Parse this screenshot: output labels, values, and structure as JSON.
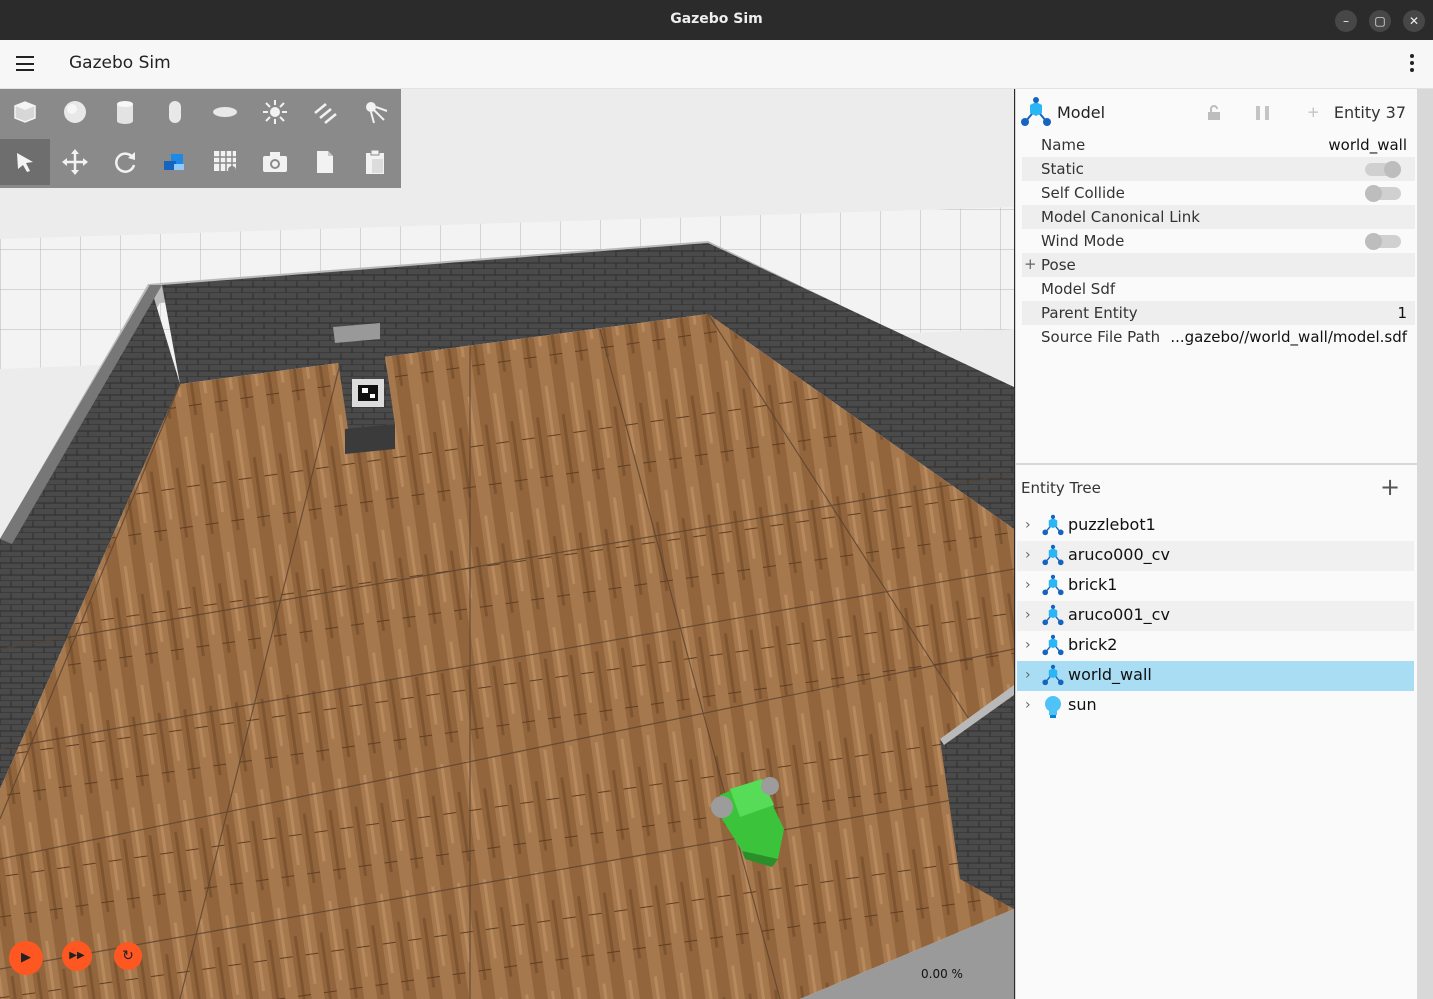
{
  "window": {
    "title": "Gazebo Sim",
    "controls": [
      "–",
      "▢",
      "✕"
    ]
  },
  "app": {
    "title": "Gazebo Sim"
  },
  "toolbar": {
    "row1": [
      {
        "name": "box-icon"
      },
      {
        "name": "sphere-icon"
      },
      {
        "name": "cylinder-icon"
      },
      {
        "name": "capsule-icon"
      },
      {
        "name": "ellipsoid-icon"
      },
      {
        "name": "point-light-icon"
      },
      {
        "name": "directional-light-icon"
      },
      {
        "name": "spot-light-icon"
      }
    ],
    "row2": [
      {
        "name": "select-mode-icon"
      },
      {
        "name": "translate-mode-icon"
      },
      {
        "name": "rotate-mode-icon"
      },
      {
        "name": "snap-icon"
      },
      {
        "name": "grid-align-icon"
      },
      {
        "name": "screenshot-icon"
      },
      {
        "name": "copy-icon"
      },
      {
        "name": "paste-icon"
      }
    ]
  },
  "playback": {
    "real_time_factor": "0.00 %"
  },
  "component_inspector": {
    "type": "Model",
    "entity": "Entity 37",
    "lock_icon": "lock-icon",
    "pause_icon": "pause-icon",
    "add_label": "+",
    "properties": [
      {
        "label": "Name",
        "value": "world_wall"
      },
      {
        "label": "Static",
        "toggle": true,
        "on": true
      },
      {
        "label": "Self Collide",
        "toggle": true,
        "on": false
      },
      {
        "label": "Model Canonical Link",
        "value": ""
      },
      {
        "label": "Wind Mode",
        "toggle": true,
        "on": false
      },
      {
        "label": "Pose",
        "value": "",
        "expander": "+"
      },
      {
        "label": "Model Sdf",
        "value": ""
      },
      {
        "label": "Parent Entity",
        "value": "1"
      },
      {
        "label": "Source File Path",
        "value": "...gazebo//world_wall/model.sdf"
      }
    ]
  },
  "entity_tree": {
    "title": "Entity Tree",
    "add_label": "+",
    "items": [
      {
        "label": "puzzlebot1",
        "icon": "model-icon"
      },
      {
        "label": "aruco000_cv",
        "icon": "model-icon"
      },
      {
        "label": "brick1",
        "icon": "model-icon"
      },
      {
        "label": "aruco001_cv",
        "icon": "model-icon"
      },
      {
        "label": "brick2",
        "icon": "model-icon"
      },
      {
        "label": "world_wall",
        "icon": "model-icon",
        "selected": true
      },
      {
        "label": "sun",
        "icon": "light-icon"
      }
    ]
  },
  "colors": {
    "accent": "#ff5722",
    "selection": "#a8ddf4",
    "model_icon": "#29b6f6"
  }
}
